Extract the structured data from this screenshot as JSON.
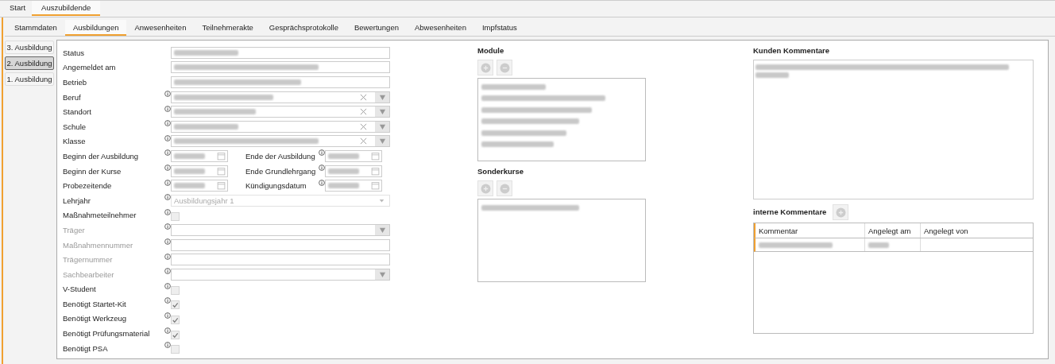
{
  "top_tabs": [
    {
      "label": "Start",
      "selected": false
    },
    {
      "label": "Auszubildende",
      "selected": true
    }
  ],
  "sub_tabs": [
    {
      "label": "Stammdaten",
      "selected": false
    },
    {
      "label": "Ausbildungen",
      "selected": true
    },
    {
      "label": "Anwesenheiten",
      "selected": false
    },
    {
      "label": "Teilnehmerakte",
      "selected": false
    },
    {
      "label": "Gesprächsprotokolle",
      "selected": false
    },
    {
      "label": "Bewertungen",
      "selected": false
    },
    {
      "label": "Abwesenheiten",
      "selected": false
    },
    {
      "label": "Impfstatus",
      "selected": false
    }
  ],
  "side_tabs": [
    {
      "label": "3. Ausbildung",
      "selected": false
    },
    {
      "label": "2. Ausbildung",
      "selected": true
    },
    {
      "label": "1. Ausbildung",
      "selected": false
    }
  ],
  "form": [
    {
      "kind": "text",
      "label": "Status",
      "info": false,
      "dimmed": false,
      "blurred": true
    },
    {
      "kind": "text",
      "label": "Angemeldet am",
      "info": false,
      "dimmed": false,
      "blurred": true
    },
    {
      "kind": "text",
      "label": "Betrieb",
      "info": false,
      "dimmed": false,
      "blurred": true
    },
    {
      "kind": "combo",
      "label": "Beruf",
      "info": true,
      "dimmed": false,
      "blurred": true
    },
    {
      "kind": "combo",
      "label": "Standort",
      "info": true,
      "dimmed": false,
      "blurred": true
    },
    {
      "kind": "combo",
      "label": "Schule",
      "info": true,
      "dimmed": false,
      "blurred": true
    },
    {
      "kind": "combo",
      "label": "Klasse",
      "info": true,
      "dimmed": false,
      "blurred": true
    },
    {
      "kind": "date-pair",
      "label": "Beginn der Ausbildung",
      "info": true,
      "dimmed": false,
      "blurred": true,
      "second": {
        "label": "Ende der Ausbildung",
        "info": true,
        "blurred": true
      }
    },
    {
      "kind": "date-pair",
      "label": "Beginn der Kurse",
      "info": true,
      "dimmed": false,
      "blurred": true,
      "second": {
        "label": "Ende Grundlehrgang",
        "info": true,
        "blurred": true
      }
    },
    {
      "kind": "date-pair",
      "label": "Probezeitende",
      "info": true,
      "dimmed": false,
      "blurred": true,
      "second": {
        "label": "Kündigungsdatum",
        "info": true,
        "blurred": true
      }
    },
    {
      "kind": "select",
      "label": "Lehrjahr",
      "info": true,
      "dimmed": false,
      "value": "Ausbildungsjahr 1"
    },
    {
      "kind": "checkbox",
      "label": "Maßnahmeteilnehmer",
      "info": true,
      "dimmed": false,
      "checked": false
    },
    {
      "kind": "dropdown",
      "label": "Träger",
      "info": true,
      "dimmed": true
    },
    {
      "kind": "text",
      "label": "Maßnahmennummer",
      "info": true,
      "dimmed": true,
      "blurred": false
    },
    {
      "kind": "text",
      "label": "Trägernummer",
      "info": true,
      "dimmed": true,
      "blurred": false
    },
    {
      "kind": "dropdown",
      "label": "Sachbearbeiter",
      "info": true,
      "dimmed": true
    },
    {
      "kind": "checkbox",
      "label": "V-Student",
      "info": true,
      "dimmed": false,
      "checked": false
    },
    {
      "kind": "checkbox",
      "label": "Benötigt Startet-Kit",
      "info": true,
      "dimmed": false,
      "checked": true
    },
    {
      "kind": "checkbox",
      "label": "Benötigt Werkzeug",
      "info": true,
      "dimmed": false,
      "checked": true
    },
    {
      "kind": "checkbox",
      "label": "Benötigt Prüfungsmaterial",
      "info": true,
      "dimmed": false,
      "checked": true
    },
    {
      "kind": "checkbox",
      "label": "Benötigt PSA",
      "info": true,
      "dimmed": false,
      "checked": false
    }
  ],
  "module": {
    "title": "Module",
    "items": [
      {
        "blurred": true
      },
      {
        "blurred": true
      },
      {
        "blurred": true
      },
      {
        "blurred": true
      },
      {
        "blurred": true
      },
      {
        "blurred": true
      }
    ]
  },
  "sonderkurse": {
    "title": "Sonderkurse",
    "items": [
      {
        "blurred": true
      }
    ]
  },
  "kunden_kommentare": {
    "title": "Kunden Kommentare",
    "lines": [
      {
        "blurred": true
      },
      {
        "blurred": true
      }
    ]
  },
  "interne_kommentare": {
    "title": "interne Kommentare",
    "columns": [
      "Kommentar",
      "Angelegt am",
      "Angelegt von"
    ],
    "rows": [
      {
        "cells": [
          {
            "blurred": true
          },
          {
            "blurred": true
          },
          {
            "blurred": false
          }
        ]
      }
    ]
  }
}
